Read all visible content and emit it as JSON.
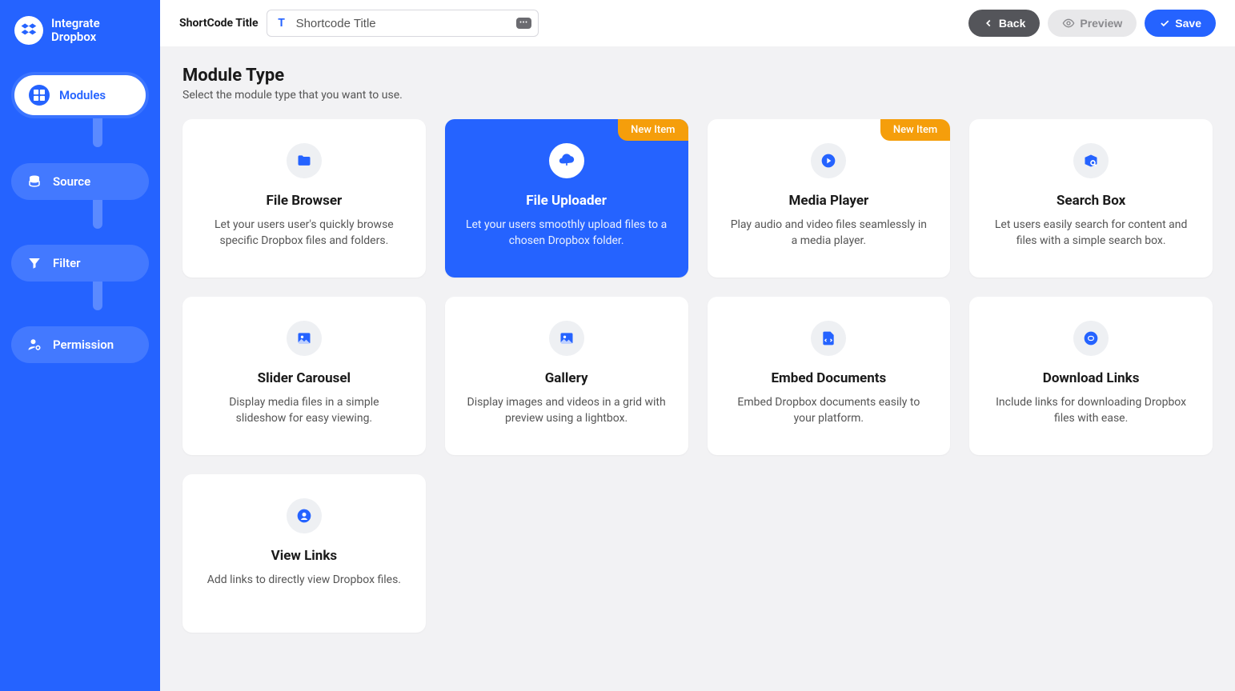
{
  "brand": {
    "line1": "Integrate",
    "line2": "Dropbox"
  },
  "sidebar": {
    "items": [
      {
        "label": "Modules",
        "icon": "grid-icon"
      },
      {
        "label": "Source",
        "icon": "database-icon"
      },
      {
        "label": "Filter",
        "icon": "funnel-icon"
      },
      {
        "label": "Permission",
        "icon": "user-cog-icon"
      }
    ]
  },
  "topbar": {
    "title_label": "ShortCode Title",
    "title_value": "Shortcode Title",
    "title_prefix": "T",
    "kbd": "•••",
    "back": "Back",
    "preview": "Preview",
    "save": "Save"
  },
  "section": {
    "heading": "Module Type",
    "subheading": "Select the module type that you want to use."
  },
  "badge_label": "New Item",
  "modules": [
    {
      "title": "File Browser",
      "desc": "Let your users user's quickly browse specific Dropbox files and folders.",
      "icon": "folder-icon"
    },
    {
      "title": "File Uploader",
      "desc": "Let your users smoothly upload files to a chosen Dropbox folder.",
      "icon": "upload-icon",
      "selected": true,
      "badge": true
    },
    {
      "title": "Media Player",
      "desc": "Play audio and video files seamlessly in a media player.",
      "icon": "play-icon",
      "badge": true
    },
    {
      "title": "Search Box",
      "desc": "Let users easily search for content and files with a simple search box.",
      "icon": "box-search-icon"
    },
    {
      "title": "Slider Carousel",
      "desc": "Display media files in a simple slideshow for easy viewing.",
      "icon": "image-icon"
    },
    {
      "title": "Gallery",
      "desc": "Display images and videos in a grid with preview using a lightbox.",
      "icon": "image-icon"
    },
    {
      "title": "Embed Documents",
      "desc": "Embed Dropbox documents easily to your platform.",
      "icon": "code-file-icon"
    },
    {
      "title": "Download Links",
      "desc": "Include links for downloading Dropbox files with ease.",
      "icon": "download-link-icon"
    },
    {
      "title": "View Links",
      "desc": "Add links to directly view Dropbox files.",
      "icon": "view-link-icon"
    }
  ],
  "colors": {
    "primary": "#2563ff",
    "badge": "#f59e0b"
  }
}
